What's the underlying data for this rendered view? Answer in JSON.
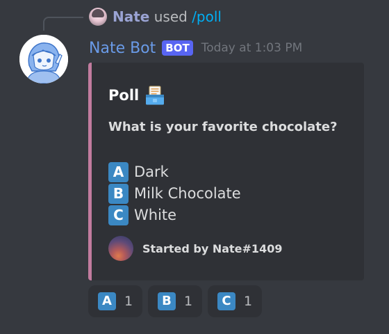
{
  "reply": {
    "user": "Nate",
    "used_text": "used",
    "command": "/poll"
  },
  "message": {
    "author": "Nate Bot",
    "bot_tag": "BOT",
    "timestamp": "Today at 1:03 PM",
    "author_color": "#6a9be8"
  },
  "embed": {
    "accent_color": "#c27c9f",
    "title": "Poll",
    "title_icon": "ballot-box-icon",
    "question": "What is your favorite chocolate?",
    "options": [
      {
        "letter": "A",
        "label": "Dark"
      },
      {
        "letter": "B",
        "label": "Milk Chocolate"
      },
      {
        "letter": "C",
        "label": "White"
      }
    ],
    "footer": "Started by Nate#1409"
  },
  "reactions": [
    {
      "letter": "A",
      "count": "1"
    },
    {
      "letter": "B",
      "count": "1"
    },
    {
      "letter": "C",
      "count": "1"
    }
  ]
}
